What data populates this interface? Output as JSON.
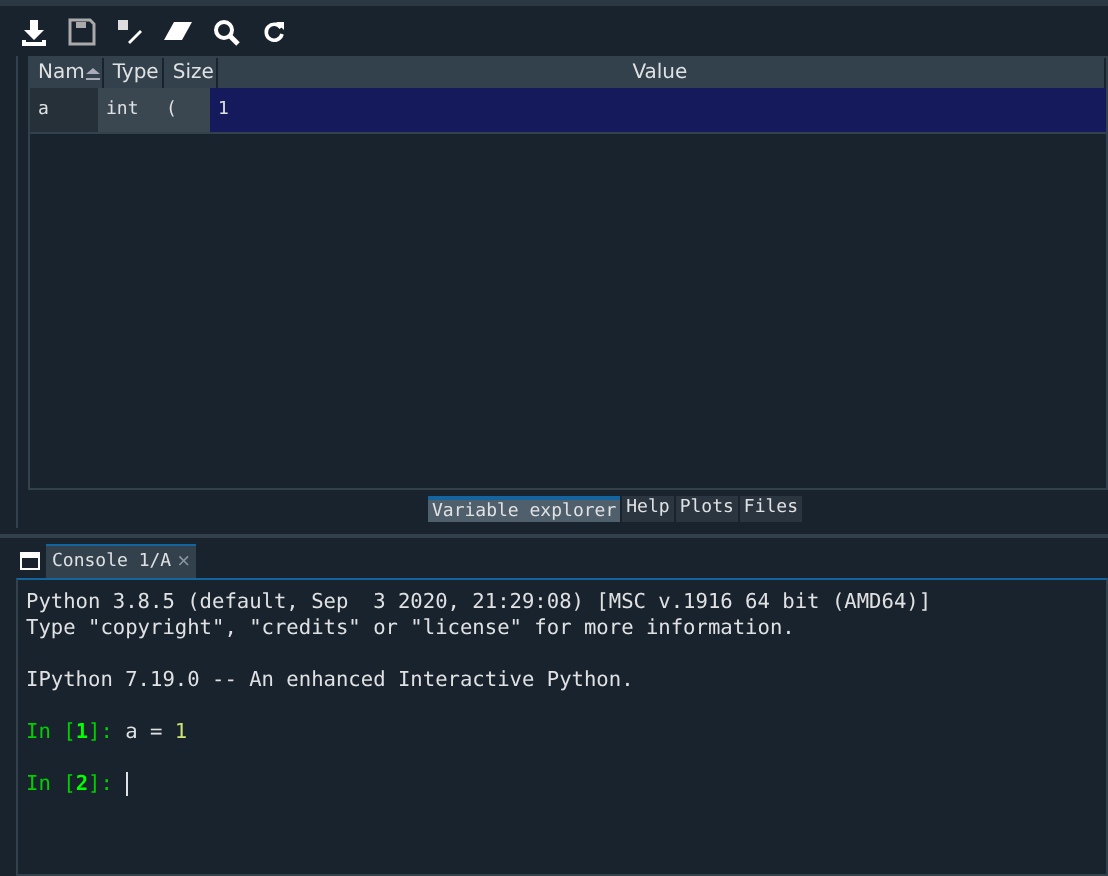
{
  "toolbar": {
    "buttons": [
      {
        "kind": "import"
      },
      {
        "kind": "save"
      },
      {
        "kind": "edit"
      },
      {
        "kind": "erase"
      },
      {
        "kind": "search"
      },
      {
        "kind": "refresh"
      }
    ]
  },
  "table": {
    "columns": [
      {
        "label": "Nam",
        "sorted": true
      },
      {
        "label": "Type",
        "sorted": false
      },
      {
        "label": "Size",
        "sorted": false
      },
      {
        "label": "Value",
        "sorted": false
      }
    ],
    "rows": [
      {
        "selected": true,
        "cells": [
          "a",
          "int",
          "(",
          "1"
        ]
      }
    ]
  },
  "pane_tabs": [
    {
      "label": "Variable explorer",
      "selected": true
    },
    {
      "label": "Help",
      "selected": false
    },
    {
      "label": "Plots",
      "selected": false
    },
    {
      "label": "Files",
      "selected": false
    }
  ],
  "console_tab": {
    "label": "Console 1/A",
    "close": "×"
  },
  "console": {
    "cursor": true,
    "blocks": [
      [
        [
          {
            "kind": "text",
            "text": "Python 3.8.5 (default, Sep  3 2020, 21:29:08) [MSC v.1916 64 bit (AMD64)]"
          }
        ],
        [
          {
            "kind": "text",
            "text": "Type \"copyright\", \"credits\" or \"license\" for more information."
          }
        ]
      ],
      [
        [
          {
            "kind": "text",
            "text": "IPython 7.19.0 -- An enhanced Interactive Python."
          }
        ]
      ],
      [
        [
          {
            "kind": "prompt",
            "text": "In ["
          },
          {
            "kind": "prompt-number",
            "text": "1"
          },
          {
            "kind": "prompt",
            "text": "]:"
          },
          {
            "kind": "text",
            "text": " a = "
          },
          {
            "kind": "number",
            "text": "1"
          }
        ]
      ],
      [
        [
          {
            "kind": "prompt",
            "text": "In ["
          },
          {
            "kind": "prompt-number",
            "text": "2"
          },
          {
            "kind": "prompt",
            "text": "]:"
          }
        ]
      ]
    ]
  }
}
